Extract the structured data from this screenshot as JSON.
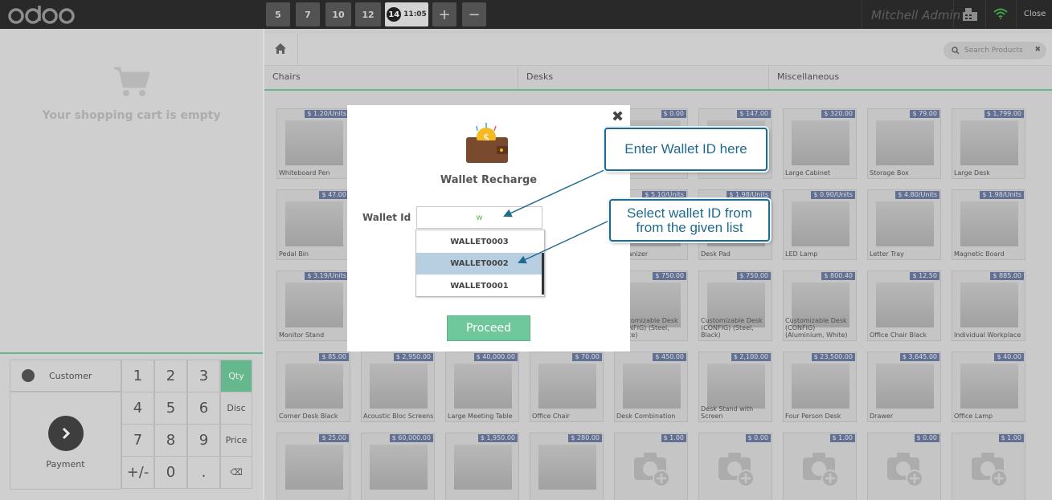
{
  "topbar": {
    "logo_text": "odoo",
    "orders": [
      "5",
      "7",
      "10",
      "12"
    ],
    "active_order": {
      "number": "14",
      "time": "11:05"
    },
    "add_label": "+",
    "remove_label": "−",
    "user": "Mitchell Admin",
    "close_label": "Close"
  },
  "cart": {
    "empty_text": "Your shopping cart is empty"
  },
  "numpad": {
    "customer_label": "Customer",
    "payment_label": "Payment",
    "keys": [
      "1",
      "2",
      "3",
      "4",
      "5",
      "6",
      "7",
      "8",
      "9",
      "+/-",
      "0",
      "."
    ],
    "modes": [
      "Qty",
      "Disc",
      "Price"
    ],
    "backspace": "⌫"
  },
  "products_header": {
    "search_placeholder": "Search Products",
    "categories": [
      "Chairs",
      "Desks",
      "Miscellaneous"
    ]
  },
  "products": [
    {
      "name": "Whiteboard Pen",
      "price": "$ 1.20/Units"
    },
    {
      "name": "",
      "price": "$ 0.00"
    },
    {
      "name": "",
      "price": "$ 147.00"
    },
    {
      "name": "Large Cabinet",
      "price": "$ 320.00"
    },
    {
      "name": "Storage Box",
      "price": "$ 79.00"
    },
    {
      "name": "Large Desk",
      "price": "$ 1,799.00"
    },
    {
      "name": "Pedal Bin",
      "price": "$ 47.00"
    },
    {
      "name": "Organizer",
      "price": "$ 5.10/Units"
    },
    {
      "name": "Desk Pad",
      "price": "$ 1.98/Units"
    },
    {
      "name": "LED Lamp",
      "price": "$ 0.90/Units"
    },
    {
      "name": "Letter Tray",
      "price": "$ 4.80/Units"
    },
    {
      "name": "Magnetic Board",
      "price": "$ 1.98/Units"
    },
    {
      "name": "Monitor Stand",
      "price": "$ 3.19/Units"
    },
    {
      "name": "Customizable Desk (CONFIG) (Steel, White)",
      "price": "$ 750.00"
    },
    {
      "name": "Customizable Desk (CONFIG) (Steel, Black)",
      "price": "$ 750.00"
    },
    {
      "name": "Customizable Desk (CONFIG) (Aluminium, White)",
      "price": "$ 800.40"
    },
    {
      "name": "Office Chair Black",
      "price": "$ 12.50"
    },
    {
      "name": "Individual Workplace",
      "price": "$ 885.00"
    },
    {
      "name": "Corner Desk Black",
      "price": "$ 85.00"
    },
    {
      "name": "Acoustic Bloc Screens",
      "price": "$ 2,950.00"
    },
    {
      "name": "Large Meeting Table",
      "price": "$ 40,000.00"
    },
    {
      "name": "Office Chair",
      "price": "$ 70.00"
    },
    {
      "name": "Desk Combination",
      "price": "$ 450.00"
    },
    {
      "name": "Desk Stand with Screen",
      "price": "$ 2,100.00"
    },
    {
      "name": "Four Person Desk",
      "price": "$ 23,500.00"
    },
    {
      "name": "Drawer",
      "price": "$ 3,645.00"
    },
    {
      "name": "Office Lamp",
      "price": "$ 40.00"
    },
    {
      "name": "",
      "price": "$ 25.00"
    },
    {
      "name": "",
      "price": "$ 60,000.00"
    },
    {
      "name": "",
      "price": "$ 1,950.00"
    },
    {
      "name": "",
      "price": "$ 280.00"
    },
    {
      "name": "",
      "price": "$ 1.00"
    },
    {
      "name": "",
      "price": "$ 0.00"
    },
    {
      "name": "",
      "price": "$ 1.00"
    },
    {
      "name": "",
      "price": "$ 0.00"
    },
    {
      "name": "",
      "price": "$ 1.00"
    }
  ],
  "modal": {
    "title": "Wallet Recharge",
    "wallet_label": "Wallet Id",
    "input_value": "w",
    "options": [
      "WALLET0003",
      "WALLET0002",
      "WALLET0001"
    ],
    "selected_option": "WALLET0002",
    "proceed_label": "Proceed",
    "close_label": "✖"
  },
  "callouts": {
    "enter_id": "Enter Wallet ID here",
    "select_id": "Select wallet ID from from the given list"
  },
  "colors": {
    "accent": "#6ec89b",
    "callout": "#1f6b8f",
    "price_badge": "#6a7aa0"
  }
}
